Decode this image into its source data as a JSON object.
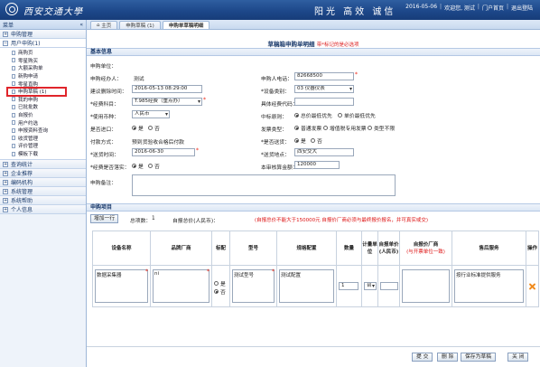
{
  "header": {
    "brand": "西安交通大學",
    "slogan": "阳光 高效 诚信",
    "date": "2016-05-06",
    "welcome": "欢迎您, 测试",
    "portal": "门户首页",
    "logout": "退出登陆"
  },
  "sidebar": {
    "title": "菜单",
    "groups": [
      {
        "label": "申购管理",
        "sign": "+"
      },
      {
        "label": "用户申购(1)",
        "sign": "−"
      }
    ],
    "items": [
      {
        "label": "商购页"
      },
      {
        "label": "零星购买"
      },
      {
        "label": "大额采购单"
      },
      {
        "label": "新购申请"
      },
      {
        "label": "零星直购"
      },
      {
        "label": "申购草稿 (1)"
      },
      {
        "label": "我的申购"
      },
      {
        "label": "已批批数"
      },
      {
        "label": "自报价"
      },
      {
        "label": "用户约选"
      },
      {
        "label": "申报资料查询"
      },
      {
        "label": "收货管理"
      },
      {
        "label": "评价管理"
      },
      {
        "label": "模板下载"
      }
    ],
    "bottom_groups": [
      {
        "label": "查询统计",
        "sign": "+"
      },
      {
        "label": "企业推荐",
        "sign": "+"
      },
      {
        "label": "编码机构",
        "sign": "+"
      },
      {
        "label": "系统管理",
        "sign": "+"
      },
      {
        "label": "系统帮助",
        "sign": "+"
      },
      {
        "label": "个人信息",
        "sign": "+"
      }
    ]
  },
  "tabs": [
    {
      "label": "主页"
    },
    {
      "label": "申购草稿 (1)"
    },
    {
      "label": "申购单草稿明细"
    }
  ],
  "form": {
    "title": "草稿箱申购单明细",
    "title_note": "带*标记的是必选项",
    "section_basic": "基本信息",
    "unit_label": "申购单位：",
    "operator_label": "申购经办人：",
    "operator_value": "测试",
    "phone_label": "申购人电话：",
    "phone_value": "82668500",
    "created_label": "建议删除时间：",
    "created_value": "2016-05-13 08:29:00",
    "category_label": "*设备类别：",
    "category_value": "03 仪器仪表",
    "funds_label": "*经费科目：",
    "funds_value": "T.985经费（重点办）",
    "funds_code_label": "具体经费代码：",
    "funds_code_value": "",
    "currency_label": "*使用币种：",
    "currency_value": "人民币",
    "principle_label": "中标原则：",
    "principle_opt1": "总价最低优先",
    "principle_opt2": "单价最低优先",
    "import_label": "是否进口：",
    "yes": "是",
    "no": "否",
    "invoice_label": "发票类型：",
    "invoice_opt1": "普通发票",
    "invoice_opt2": "增值税专用发票",
    "invoice_opt3": "类型不限",
    "payment_label": "付款方式：",
    "payment_value": "预到货验收合格后付款",
    "delivery_label": "*是否送货：",
    "deliver_time_label": "*送货时间：",
    "deliver_time_value": "2016-06-30",
    "deliver_place_label": "*送货地点：",
    "deliver_place_value": "西安交大",
    "self_pick_label": "*经费是否落实：",
    "budget_label": "本审核算金额：",
    "budget_value": "120000",
    "remark_label": "申购备注："
  },
  "items_section": {
    "title": "申购项目",
    "add_button": "增加一行",
    "count_label": "总项数：",
    "count_value": "1",
    "self_price_label": "自报总价(人民币)：",
    "notice": "(自报总价不能大于150000元 自报价厂商必须与最终报价报名，并可真实或交)"
  },
  "table": {
    "headers": [
      "设备名称",
      "品牌厂商",
      "标配",
      "型号",
      "规格配置",
      "数量",
      "计量单位",
      "自报单价(人民币)",
      "自报价厂商",
      "售后服务",
      "操作"
    ],
    "supplier_note": "(与开票单位一致)",
    "rows": [
      {
        "name": "数据采集器",
        "brand": "ni",
        "std_yes": "是",
        "std_no": "否",
        "model": "测试型号",
        "spec": "测试配置",
        "qty": "1",
        "unit": "台",
        "price": "",
        "supplier": "",
        "service": "按行业标准提供服务"
      }
    ]
  },
  "footer": {
    "submit": "提 交",
    "delete": "删 除",
    "save_draft": "保存为草稿",
    "close": "关 闭"
  }
}
